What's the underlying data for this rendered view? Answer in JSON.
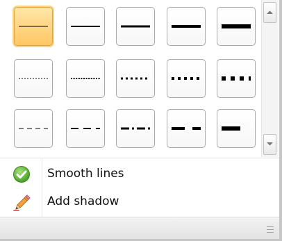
{
  "gallery": {
    "selected_index": 0,
    "styles": [
      {
        "pattern": "solid",
        "weight": 1
      },
      {
        "pattern": "solid",
        "weight": 2
      },
      {
        "pattern": "solid",
        "weight": 3
      },
      {
        "pattern": "solid",
        "weight": 4
      },
      {
        "pattern": "solid",
        "weight": 6
      },
      {
        "pattern": "dotted",
        "weight": 1
      },
      {
        "pattern": "dotted",
        "weight": 2
      },
      {
        "pattern": "dotted",
        "weight": 3
      },
      {
        "pattern": "dotted",
        "weight": 4
      },
      {
        "pattern": "dotted",
        "weight": 6
      },
      {
        "pattern": "dashed",
        "weight": 1
      },
      {
        "pattern": "dashed",
        "weight": 2
      },
      {
        "pattern": "dash-dot",
        "weight": 3
      },
      {
        "pattern": "dashed",
        "weight": 4
      },
      {
        "pattern": "dashed",
        "weight": 6
      }
    ]
  },
  "scrollbar": {
    "up_icon": "scroll-up-arrow-icon",
    "down_icon": "scroll-down-arrow-icon"
  },
  "menu": {
    "items": [
      {
        "label": "Smooth lines",
        "icon": "green-checkmark-icon"
      },
      {
        "label": "Add shadow",
        "icon": "pencil-icon"
      }
    ]
  },
  "footer": {
    "grip_icon": "resize-grip-icon"
  },
  "colors": {
    "selected_fill": "#ffc764",
    "selected_border": "#e2a33d",
    "tile_border": "#a9a9a9",
    "check_green": "#5bb531",
    "line_color": "#000000"
  }
}
